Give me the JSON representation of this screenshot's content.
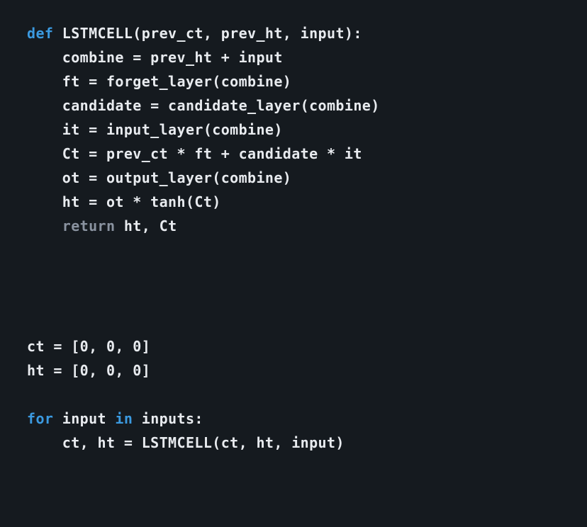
{
  "line1": {
    "kw": "def",
    "rest": " LSTMCELL(prev_ct, prev_ht, input):"
  },
  "line2": "    combine = prev_ht + input",
  "line3": "    ft = forget_layer(combine)",
  "line4": "    candidate = candidate_layer(combine)",
  "line5": "    it = input_layer(combine)",
  "line6": "    Ct = prev_ct * ft + candidate * it",
  "line7": "    ot = output_layer(combine)",
  "line8": "    ht = ot * tanh(Ct)",
  "line9": {
    "indent": "    ",
    "kw": "return",
    "rest": " ht, Ct"
  },
  "line11": "ct = [0, 0, 0]",
  "line12": "ht = [0, 0, 0]",
  "line13": {
    "kw": "for",
    "mid": " input ",
    "in": "in",
    "rest": " inputs:"
  },
  "line14": "    ct, ht = LSTMCELL(ct, ht, input)"
}
